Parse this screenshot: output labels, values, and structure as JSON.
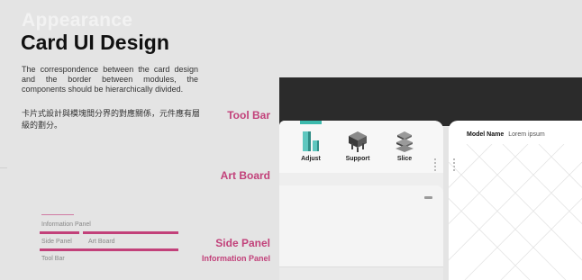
{
  "heading": {
    "eyebrow": "Appearance",
    "title": "Card UI Design",
    "description_en": "The correspondence between the card design and the border between modules, the components should be hierarchically divided.",
    "description_zh": "卡片式設計與模塊間分界的對應關係，元件應有層級的劃分。"
  },
  "labels": {
    "tool_bar": "Tool Bar",
    "art_board": "Art Board",
    "side_panel": "Side Panel",
    "information_panel": "Information Panel"
  },
  "legend": {
    "information_panel": "Information Panel",
    "side_panel": "Side Panel",
    "art_board": "Art Board",
    "tool_bar": "Tool Bar",
    "accent_color": "#c2417a"
  },
  "toolbar": {
    "tools": [
      {
        "label": "Adjust",
        "icon": "adjust-icon"
      },
      {
        "label": "Support",
        "icon": "support-icon"
      },
      {
        "label": "Slice",
        "icon": "slice-icon"
      }
    ],
    "active_accent": "#3bb9ac"
  },
  "info_panel": {
    "model_name_label": "Model Name",
    "model_name_value": "Lorem ipsum"
  }
}
